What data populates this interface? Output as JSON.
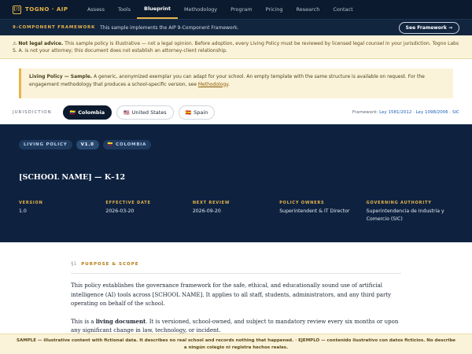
{
  "nav": {
    "brand_mark": "[/]",
    "brand": "TOGNO · AIP",
    "links": [
      "Assess",
      "Tools",
      "Blueprint",
      "Methodology",
      "Program",
      "Pricing",
      "Research",
      "Contact"
    ]
  },
  "framework_bar": {
    "tag": "9-COMPONENT FRAMEWORK",
    "text": "This sample implements the AIP 9-Component Framework.",
    "button": "See Framework →"
  },
  "legal": {
    "icon": "⚠",
    "bold": "Not legal advice.",
    "text": " This sample policy is illustrative — not a legal opinion. Before adoption, every Living Policy must be reviewed by licensed legal counsel in your jurisdiction. Togno Labs S. A. is not your attorney; this document does not establish an attorney-client relationship."
  },
  "sample_box": {
    "bold": "Living Policy — Sample.",
    "text": " A generic, anonymized exemplar you can adapt for your school. An empty template with the same structure is available on request. For the engagement methodology that produces a school-specific version, see ",
    "link": "Methodology",
    "end": "."
  },
  "jurisdiction": {
    "label": "JURISDICTION",
    "options": [
      {
        "flag": "🇨🇴",
        "label": "Colombia"
      },
      {
        "flag": "🇺🇸",
        "label": "United States"
      },
      {
        "flag": "🇪🇸",
        "label": "Spain"
      }
    ],
    "law_prefix": "Framework:",
    "law_links": "Ley 1581/2012 · Ley 1098/2006 · SIC"
  },
  "hero": {
    "badge_type": "LIVING POLICY",
    "badge_version": "V1.0",
    "badge_country": "🇨🇴 COLOMBIA",
    "title": "[SCHOOL NAME] — K–12",
    "meta": [
      {
        "label": "VERSION",
        "value": "1.0"
      },
      {
        "label": "EFFECTIVE DATE",
        "value": "2026-03-20"
      },
      {
        "label": "NEXT REVIEW",
        "value": "2026-09-20"
      },
      {
        "label": "POLICY OWNERS",
        "value": "Superintendent & IT Director"
      },
      {
        "label": "GOVERNING AUTHORITY",
        "value": "Superintendencia de Industria y Comercio (SIC)"
      }
    ]
  },
  "section": {
    "number": "§1",
    "title": "PURPOSE & SCOPE",
    "para1": "This policy establishes the governance framework for the safe, ethical, and educationally sound use of artificial intelligence (AI) tools across [SCHOOL NAME]. It applies to all staff, students, administrators, and any third party operating on behalf of the school.",
    "para2_pre": "This is a ",
    "para2_bold": "living document",
    "para2_post": ". It is versioned, school-owned, and subject to mandatory review every six months or upon any significant change in law, technology, or incident."
  },
  "footer": "SAMPLE — illustrative content with fictional data. It describes no real school and records nothing that happened. · EJEMPLO — contenido ilustrativo con datos ficticios. No describe a ningún colegio ni registra hechos reales."
}
